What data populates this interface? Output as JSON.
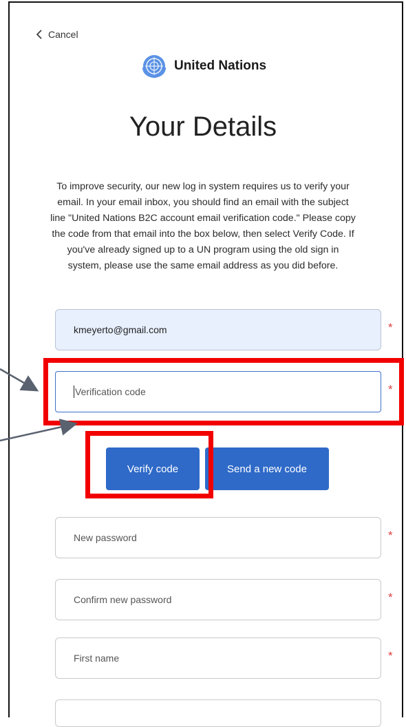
{
  "nav": {
    "cancel_label": "Cancel"
  },
  "brand": {
    "name": "United Nations"
  },
  "page": {
    "title": "Your Details",
    "intro": "To improve security, our new log in system requires us to verify your email. In your email inbox, you should find an email with the subject line \"United Nations B2C account email verification code.\" Please copy the code from that email into the box below, then select Verify Code. If you've already signed up to a UN program using the old sign in system, please use the same email address as you did before."
  },
  "form": {
    "email": {
      "value": "kmeyerto@gmail.com"
    },
    "verification_code": {
      "placeholder": "Verification code"
    },
    "verify_button": "Verify code",
    "send_new_code_button": "Send a new code",
    "new_password": {
      "placeholder": "New password"
    },
    "confirm_password": {
      "placeholder": "Confirm new password"
    },
    "first_name": {
      "placeholder": "First name"
    },
    "required_marker": "*"
  },
  "colors": {
    "button": "#2f6ac8",
    "highlight": "#f20000",
    "required": "#e04040",
    "filled_field": "#e8f0fe"
  }
}
